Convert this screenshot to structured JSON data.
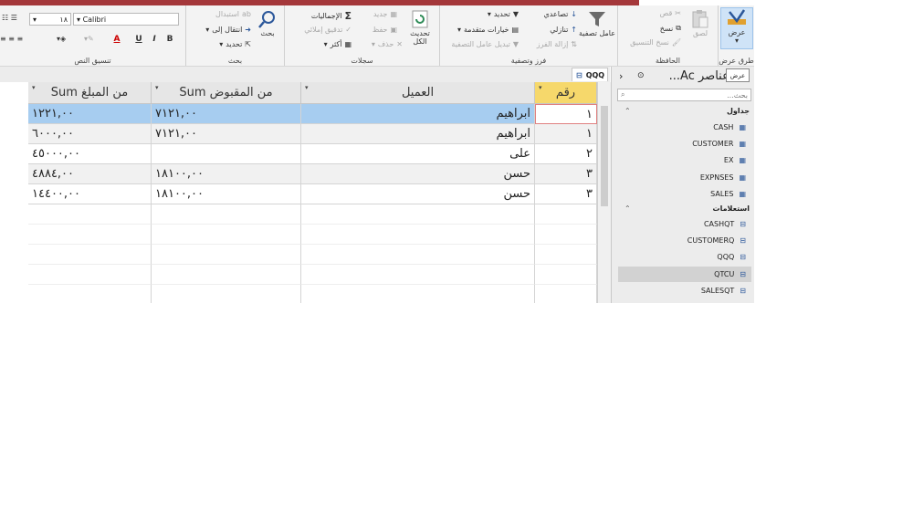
{
  "ribbon": {
    "view": {
      "label": "عرض",
      "group": "طرق عرض"
    },
    "clipboard": {
      "paste": "لصق",
      "cut": "قص",
      "copy": "نسخ",
      "format_painter": "نسخ التنسيق",
      "group": "الحافظة"
    },
    "sort_filter": {
      "filter": "عامل تصفية",
      "ascending": "تصاعدي",
      "descending": "تنازلي",
      "remove_sort": "إزالة الفرز",
      "selection": "تحديد",
      "advanced": "خيارات متقدمة",
      "toggle_filter": "تبديل عامل التصفية",
      "group": "فرز وتصفية"
    },
    "records": {
      "refresh_all": "تحديث الكل",
      "new": "جديد",
      "save": "حفظ",
      "delete": "حذف",
      "totals": "الإجماليات",
      "spelling": "تدقيق إملائي",
      "more": "أكثر",
      "group": "سجلات"
    },
    "find": {
      "find": "بحث",
      "replace": "استبدال",
      "goto": "انتقال إلى",
      "select": "تحديد",
      "group": "بحث"
    },
    "text_format": {
      "font": "Calibri",
      "size": "١٨",
      "bold": "B",
      "italic": "I",
      "underline": "U",
      "font_color": "A",
      "group": "تنسيق النص"
    }
  },
  "tooltip": "عرض",
  "tab": {
    "label": "QQQ"
  },
  "columns": [
    "رقم",
    "العميل",
    "من المقبوض Sum",
    "من المبلغ Sum"
  ],
  "rows": [
    {
      "id": "١",
      "customer": "ابراهيم",
      "received": "٧١٢١,٠٠",
      "amount": "١٢٢١,٠٠"
    },
    {
      "id": "١",
      "customer": "ابراهيم",
      "received": "٧١٢١,٠٠",
      "amount": "٦٠٠٠,٠٠"
    },
    {
      "id": "٢",
      "customer": "على",
      "received": "",
      "amount": "٤٥٠٠٠,٠٠"
    },
    {
      "id": "٣",
      "customer": "حسن",
      "received": "١٨١٠٠,٠٠",
      "amount": "٤٨٨٤,٠٠"
    },
    {
      "id": "٣",
      "customer": "حسن",
      "received": "١٨١٠٠,٠٠",
      "amount": "١٤٤٠٠,٠٠"
    }
  ],
  "nav": {
    "title": "كل عناصر Ac...",
    "search_placeholder": "بحث...",
    "tables_label": "جداول",
    "tables": [
      "CASH",
      "CUSTOMER",
      "EX",
      "EXPNSES",
      "SALES"
    ],
    "queries_label": "استعلامات",
    "queries": [
      "CASHQT",
      "CUSTOMERQ",
      "QQQ",
      "QTCU",
      "SALESQT"
    ]
  }
}
